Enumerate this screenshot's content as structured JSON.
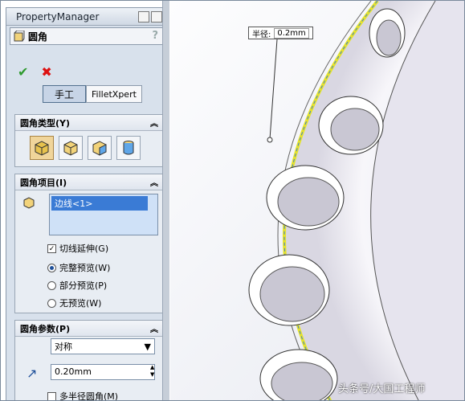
{
  "property_manager": {
    "title": "PropertyManager",
    "feature_name": "圆角",
    "help_label": "?",
    "mode_buttons": [
      "手工",
      "FilletXpert"
    ]
  },
  "fillet_type": {
    "header": "圆角类型(Y)"
  },
  "fillet_items": {
    "header": "圆角项目(I)",
    "selected_edge": "边线<1>",
    "tangent_propagation_label": "切线延伸(G)",
    "preview_options": [
      "完整预览(W)",
      "部分预览(P)",
      "无预览(W)"
    ]
  },
  "fillet_params": {
    "header": "圆角参数(P)",
    "mode_value": "对称",
    "radius_value": "0.20mm",
    "multi_radius_label": "多半径圆角(M)"
  },
  "viewport": {
    "callout_label": "半径:",
    "callout_value": "0.2mm",
    "watermark": "头条号/大国工程师"
  }
}
